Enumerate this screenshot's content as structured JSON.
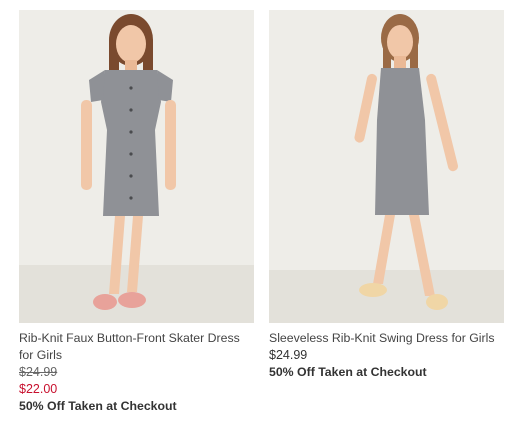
{
  "products": [
    {
      "title": "Rib-Knit Faux Button-Front Skater Dress for Girls",
      "original_price": "$24.99",
      "sale_price": "$22.00",
      "promo": "50% Off Taken at Checkout",
      "image_icon": "product-photo"
    },
    {
      "title": "Sleeveless Rib-Knit Swing Dress for Girls",
      "price": "$24.99",
      "promo": "50% Off Taken at Checkout",
      "image_icon": "product-photo"
    }
  ],
  "colors": {
    "sale_red": "#c8102e",
    "text": "#333333",
    "photo_bg": "#ecebe6",
    "dress_gray": "#8f9196"
  }
}
